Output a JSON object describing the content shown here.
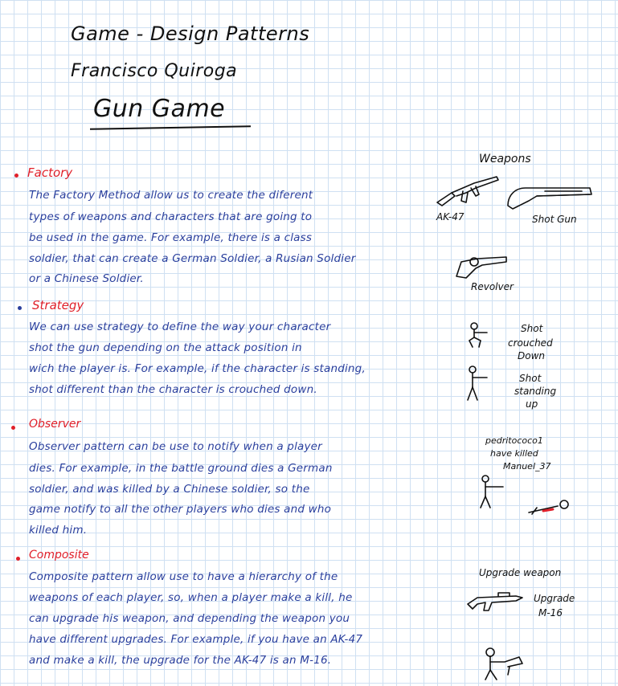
{
  "header": {
    "line1": "Game - Design Patterns",
    "line2": "Francisco Quiroga",
    "game_title": "Gun Game"
  },
  "sections": [
    {
      "name": "Factory",
      "lines": [
        "The Factory Method allow us to create the diferent",
        "types of weapons and characters that are going to",
        "be used in the game. For example, there is a class",
        "soldier, that can create a German Soldier, a Rusian Soldier",
        "or a Chinese Soldier."
      ]
    },
    {
      "name": "Strategy",
      "lines": [
        "We can use strategy to define the way your character",
        "shot the gun depending on the attack position in",
        "wich the player is. For example, if the character is standing,",
        "shot different than the character is crouched down."
      ]
    },
    {
      "name": "Observer",
      "lines": [
        "Observer pattern can be use to notify when a player",
        "dies. For example, in the battle ground dies a German",
        "soldier, and was killed by a Chinese soldier, so the",
        "game notify to all the other players who dies and who",
        "killed him."
      ]
    },
    {
      "name": "Composite",
      "lines": [
        "Composite pattern allow use to have a hierarchy of the",
        "weapons of each player, so, when a player make a kill, he",
        "can upgrade his weapon, and depending the weapon you",
        "have different upgrades. For example, if you have an AK-47",
        "and make a kill, the upgrade for the AK-47 is an M-16."
      ]
    }
  ],
  "sidebar": {
    "weapons_title": "Weapons",
    "ak47": "AK-47",
    "shotgun": "Shot Gun",
    "revolver": "Revolver",
    "crouched_lines": [
      "Shot",
      "crouched",
      "Down"
    ],
    "standing_lines": [
      "Shot",
      "standing",
      "up"
    ],
    "kill_feed_lines": [
      "pedritococo1",
      "have killed",
      "Manuel_37"
    ],
    "upgrade_title": "Upgrade weapon",
    "upgrade_lines": [
      "Upgrade",
      "M-16"
    ]
  },
  "colors": {
    "heading_red": "#e0202a",
    "body_blue": "#2a3f9d",
    "ink_black": "#111111",
    "grid_blue": "#cfe0f2"
  }
}
